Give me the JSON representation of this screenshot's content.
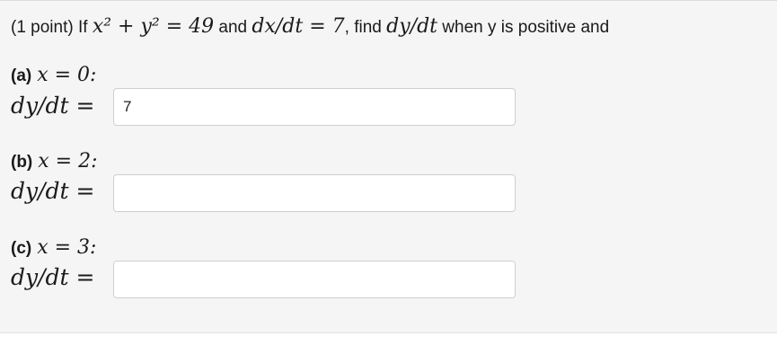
{
  "question": {
    "prefix": "(1 point) If",
    "eq1": "x² + y² = 49",
    "and1": "and",
    "eq2": "dx/dt = 7",
    "mid": ", find",
    "target": "dy/dt",
    "suffix": "when y is positive and"
  },
  "parts": [
    {
      "letter": "(a)",
      "condition": "x = 0:",
      "label": "dy/dt =",
      "value": "7"
    },
    {
      "letter": "(b)",
      "condition": "x = 2:",
      "label": "dy/dt =",
      "value": ""
    },
    {
      "letter": "(c)",
      "condition": "x = 3:",
      "label": "dy/dt =",
      "value": ""
    }
  ]
}
